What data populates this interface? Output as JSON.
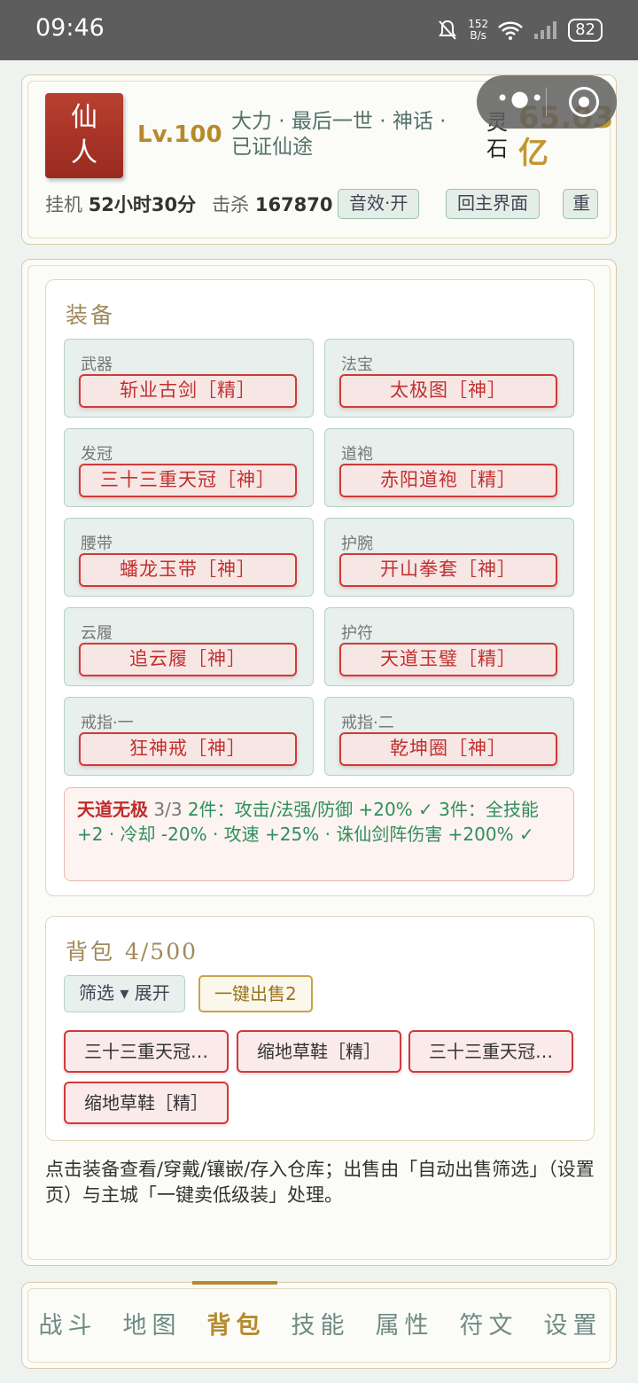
{
  "status": {
    "time": "09:46",
    "net_speed": "152",
    "net_unit": "B/s",
    "battery": "82"
  },
  "header": {
    "avatar_line1": "仙",
    "avatar_line2": "人",
    "level": "Lv.100",
    "titles": "大力 · 最后一世 · 神话 · 已证仙途",
    "stone_label": "灵石",
    "stone_value": "65.03亿",
    "afk_label": "挂机",
    "afk_value": "52小时30分",
    "kills_label": "击杀",
    "kills_value": "167870",
    "sound_button": "音效·开",
    "home_button": "回主界面",
    "reset_button": "重"
  },
  "equipment": {
    "title": "装备",
    "slots": [
      {
        "label": "武器",
        "item": "斩业古剑［精］"
      },
      {
        "label": "法宝",
        "item": "太极图［神］"
      },
      {
        "label": "发冠",
        "item": "三十三重天冠［神］"
      },
      {
        "label": "道袍",
        "item": "赤阳道袍［精］"
      },
      {
        "label": "腰带",
        "item": "蟠龙玉带［神］"
      },
      {
        "label": "护腕",
        "item": "开山拳套［神］"
      },
      {
        "label": "云履",
        "item": "追云履［神］"
      },
      {
        "label": "护符",
        "item": "天道玉璧［精］"
      },
      {
        "label": "戒指·一",
        "item": "狂神戒［神］"
      },
      {
        "label": "戒指·二",
        "item": "乾坤圈［神］"
      }
    ],
    "set": {
      "name": "天道无极",
      "count": "3/3",
      "effects": "2件：攻击/法强/防御 +20% ✓ 3件：全技能 +2 · 冷却 -20% · 攻速 +25% · 诛仙剑阵伤害 +200% ✓"
    }
  },
  "bag": {
    "title": "背包",
    "capacity": "4/500",
    "filter_button": "筛选 ▾ 展开",
    "sell_button": "一键出售2",
    "items": [
      "三十三重天冠…",
      "缩地草鞋［精］",
      "三十三重天冠…",
      "缩地草鞋［精］"
    ]
  },
  "hint": "点击装备查看/穿戴/镶嵌/存入仓库；出售由「自动出售筛选」（设置页）与主城「一键卖低级装」处理。",
  "nav": {
    "items": [
      "战斗",
      "地图",
      "背包",
      "技能",
      "属性",
      "符文",
      "设置"
    ],
    "active": "背包"
  }
}
